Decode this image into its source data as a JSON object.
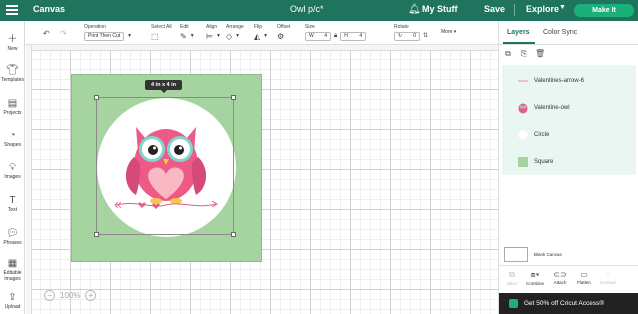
{
  "topbar": {
    "app_title": "Canvas",
    "doc_title": "Owl p/c*",
    "my_stuff": "My Stuff",
    "save": "Save",
    "explore": "Explore",
    "make_it": "Make It",
    "bg_color": "#20735c",
    "make_it_color": "#1ab07a"
  },
  "toolbar": {
    "operation_label": "Operation",
    "operation_value": "Print Then Cut",
    "select_all": "Select All",
    "edit": "Edit",
    "align": "Align",
    "arrange": "Arrange",
    "flip": "Flip",
    "offset": "Offset",
    "size": "Size",
    "size_w_label": "W",
    "size_w_value": "4",
    "size_h_label": "H",
    "size_h_value": "4",
    "rotate": "Rotate",
    "rotate_value": "0",
    "more": "More"
  },
  "sidebar": {
    "items": [
      {
        "label": "New",
        "icon": "plus-icon"
      },
      {
        "label": "Templates",
        "icon": "shirt-icon"
      },
      {
        "label": "Projects",
        "icon": "projects-icon"
      },
      {
        "label": "Shapes",
        "icon": "shapes-icon"
      },
      {
        "label": "Images",
        "icon": "lightbulb-icon"
      },
      {
        "label": "Text",
        "icon": "text-icon"
      },
      {
        "label": "Phrases",
        "icon": "phrases-icon"
      },
      {
        "label": "Editable Images",
        "icon": "editable-images-icon"
      },
      {
        "label": "Upload",
        "icon": "upload-icon"
      }
    ]
  },
  "canvas": {
    "size_badge": "4 in x 4 in",
    "zoom": "100%",
    "square_color": "#a6d4a1"
  },
  "panel": {
    "tab_layers": "Layers",
    "tab_color_sync": "Color Sync",
    "layers": [
      {
        "name": "Valentines-arrow-6",
        "thumb": "arrow-thumb-icon"
      },
      {
        "name": "Valentine-owl",
        "thumb": "owl-thumb-icon"
      },
      {
        "name": "Circle",
        "thumb": "circle-thumb-icon"
      },
      {
        "name": "Square",
        "thumb": "square-thumb-icon"
      }
    ],
    "blank_canvas": "Blank Canvas",
    "actions": [
      {
        "label": "Slice",
        "enabled": false
      },
      {
        "label": "Combine",
        "enabled": true
      },
      {
        "label": "Attach",
        "enabled": true
      },
      {
        "label": "Flatten",
        "enabled": true
      },
      {
        "label": "Contour",
        "enabled": false
      }
    ],
    "promo": "Get 50% off Cricut Access®"
  }
}
